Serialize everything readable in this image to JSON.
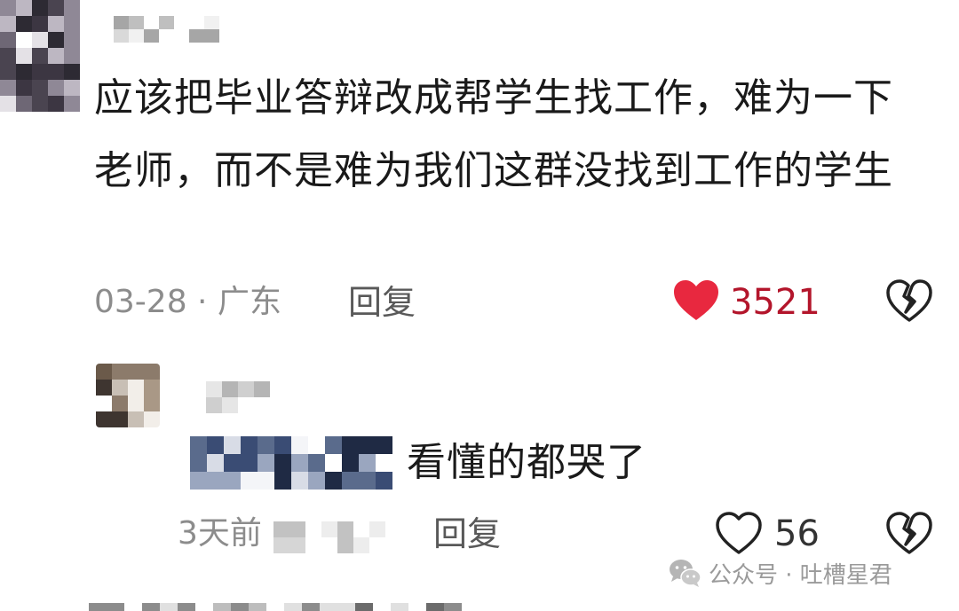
{
  "comment": {
    "text": "应该把毕业答辩改成帮学生找工作，难为一下老师，而不是难为我们这群没找到工作的学生",
    "date_location": "03-28 · 广东",
    "reply_label": "回复",
    "like_count": "3521",
    "liked": true,
    "like_color": "#e8283f"
  },
  "reply": {
    "text": "看懂的都哭了",
    "date": "3天前",
    "reply_label": "回复",
    "like_count": "56",
    "liked": false
  },
  "watermark": {
    "text": "公众号 · 吐槽星君",
    "icon": "wechat-icon"
  },
  "icons": {
    "like": "heart-icon",
    "dislike": "broken-heart-icon"
  }
}
